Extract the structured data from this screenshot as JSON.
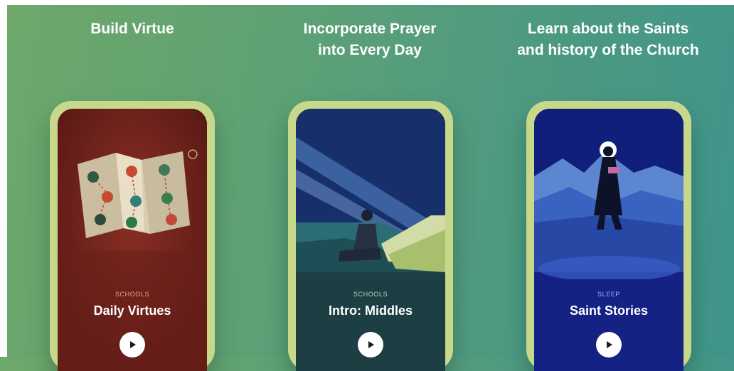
{
  "features": [
    {
      "headline": "Build Virtue"
    },
    {
      "headline": "Incorporate Prayer\ninto Every Day"
    },
    {
      "headline": "Learn about the Saints\nand history of the Church"
    }
  ],
  "cards": [
    {
      "category": "SCHOOLS",
      "title": "Daily Virtues",
      "category_color": "#e9a775",
      "background": "#6e221c"
    },
    {
      "category": "SCHOOLS",
      "title": "Intro: Middles",
      "category_color": "#b9d2c4",
      "background": "#1d3f43"
    },
    {
      "category": "SLEEP",
      "title": "Saint Stories",
      "category_color": "#8fb6ff",
      "background": "#142283"
    }
  ],
  "icons": {
    "play": "play-icon"
  }
}
